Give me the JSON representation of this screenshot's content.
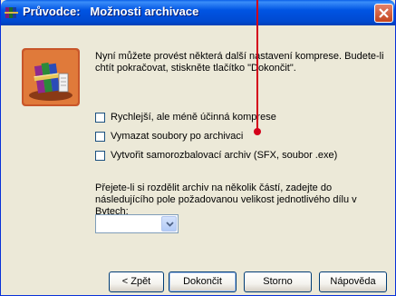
{
  "window": {
    "title": "Průvodce:   Možnosti archivace",
    "icon": "winrar-books-icon"
  },
  "intro_text": "Nyní můžete provést některá další nastavení komprese. Budete-li chtít pokračovat, stiskněte tlačítko \"Dokončit\".",
  "options": [
    {
      "label": "Rychlejší, ale méně účinná komprese",
      "checked": false
    },
    {
      "label": "Vymazat soubory po archivaci",
      "checked": false
    },
    {
      "label": "Vytvořit samorozbalovací archiv (SFX, soubor .exe)",
      "checked": false
    }
  ],
  "split_text": "Přejete-li si rozdělit archiv na několik částí, zadejte do následujícího pole požadovanou velikost jednotlivého dílu v Bytech:",
  "volume_size": {
    "value": ""
  },
  "buttons": {
    "back": "< Zpět",
    "finish": "Dokončit",
    "cancel": "Storno",
    "help": "Nápověda"
  },
  "colors": {
    "titlebar": "#0054e3",
    "dialog_bg": "#ece9d8",
    "close": "#c4441d",
    "annotation": "#d4001a"
  }
}
